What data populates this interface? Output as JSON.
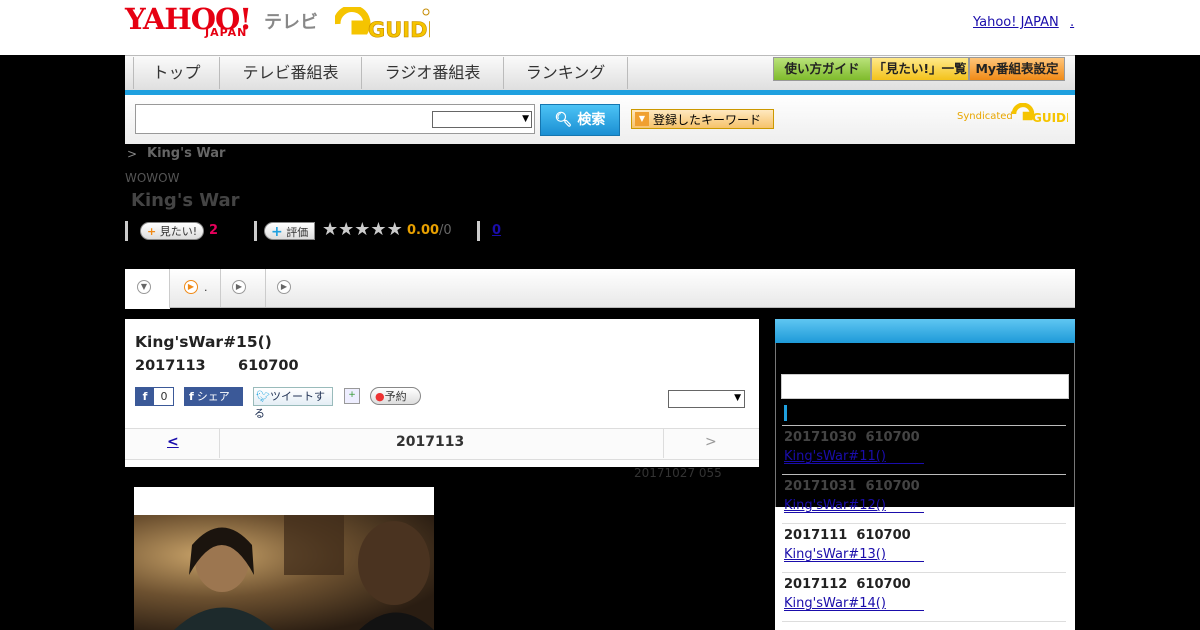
{
  "header": {
    "yahoo_logo": "YAHOO!",
    "japan_sub": "JAPAN",
    "tv_label": "テレビ",
    "gguide_logo": "GUIDE",
    "yahoo_japan_link": "Yahoo! JAPAN",
    "link_dot": "."
  },
  "nav": {
    "tabs": [
      "トップ",
      "テレビ番組表",
      "ラジオ番組表",
      "ランキング"
    ],
    "guide_button": "使い方ガイド",
    "mitai_button": "「見たい!」一覧",
    "my_button": "My番組表設定"
  },
  "search": {
    "button_label": "検索",
    "keyword_button": "登録したキーワード",
    "syndicated": "Syndicated"
  },
  "breadcrumb": {
    "arrow": ">",
    "title": "King's War"
  },
  "program": {
    "channel": "WOWOW",
    "title": "King's War",
    "mitai_label": "見たい!",
    "mitai_count": "2",
    "rate_label": "評価",
    "rating": "0.00",
    "rating_count": "/0",
    "review_count": "0"
  },
  "tabs": {
    "second_suffix": "."
  },
  "episode": {
    "title": "King'sWar#15()",
    "date": "2017113",
    "time": "610700",
    "fb_count": "0",
    "share_label": "シェア",
    "tweet_label": "ツイートする",
    "reserve_label": "予約",
    "prev": "<",
    "day": "2017113",
    "next": ">",
    "updated": "20171027 055"
  },
  "sidebar": {
    "items": [
      {
        "date": "20171030",
        "time": "610700",
        "link": "King'sWar#11()"
      },
      {
        "date": "20171031",
        "time": "610700",
        "link": "King'sWar#12()"
      },
      {
        "date": "2017111",
        "time": "610700",
        "link": "King'sWar#13()"
      },
      {
        "date": "2017112",
        "time": "610700",
        "link": "King'sWar#14()"
      }
    ]
  },
  "colors": {
    "accent_blue": "#1fa0df",
    "yahoo_red": "#e60012",
    "gguide_yellow": "#f5c400"
  }
}
